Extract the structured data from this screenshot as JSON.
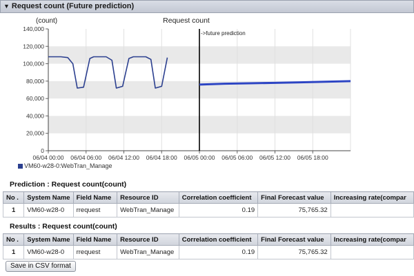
{
  "panel": {
    "title": "Request count (Future prediction)"
  },
  "chart_data": {
    "type": "line",
    "title": "Request count",
    "ylabel": "(count)",
    "ylim": [
      0,
      140000
    ],
    "yticks": [
      "0",
      "20,000",
      "40,000",
      "60,000",
      "80,000",
      "100,000",
      "120,000",
      "140,000"
    ],
    "x_tick_labels": [
      "06/04 00:00",
      "06/04 06:00",
      "06/04 12:00",
      "06/04 18:00",
      "06/05 00:00",
      "06/05 06:00",
      "06/05 12:00",
      "06/05 18:00"
    ],
    "xlim_hours": [
      0,
      48
    ],
    "divider_hour": 24,
    "annotation": "->future prediction",
    "legend": [
      "VM60-w28-0:WebTran_Manage"
    ],
    "series": [
      {
        "name": "VM60-w28-0:WebTran_Manage",
        "kind": "actual",
        "points": [
          [
            0,
            108000
          ],
          [
            2,
            108000
          ],
          [
            3.1,
            107000
          ],
          [
            3.9,
            100000
          ],
          [
            4.6,
            72000
          ],
          [
            5.6,
            73000
          ],
          [
            6.6,
            106000
          ],
          [
            7.2,
            108000
          ],
          [
            9.2,
            108000
          ],
          [
            10.1,
            104000
          ],
          [
            10.8,
            72000
          ],
          [
            11.8,
            74000
          ],
          [
            12.8,
            106000
          ],
          [
            13.5,
            108000
          ],
          [
            15.5,
            108000
          ],
          [
            16.3,
            105000
          ],
          [
            17.0,
            72000
          ],
          [
            18.0,
            74000
          ],
          [
            18.9,
            107000
          ]
        ]
      },
      {
        "name": "VM60-w28-0:WebTran_Manage",
        "kind": "prediction",
        "points": [
          [
            24,
            76000
          ],
          [
            28,
            77000
          ],
          [
            32,
            77500
          ],
          [
            36,
            78000
          ],
          [
            40,
            78600
          ],
          [
            44,
            79300
          ],
          [
            48,
            80000
          ]
        ]
      }
    ]
  },
  "prediction": {
    "title": "Prediction : Request count(count)",
    "columns": [
      "No .",
      "System Name",
      "Field Name",
      "Resource ID",
      "Correlation coefficient",
      "Final Forecast value",
      "Increasing rate(compar"
    ],
    "rows": [
      [
        "1",
        "VM60-w28-0",
        "rrequest",
        "WebTran_Manage",
        "0.19",
        "75,765.32",
        ""
      ]
    ]
  },
  "results": {
    "title": "Results : Request count(count)",
    "columns": [
      "No .",
      "System Name",
      "Field Name",
      "Resource ID",
      "Correlation coefficient",
      "Final Forecast value",
      "Increasing rate(compar"
    ],
    "rows": [
      [
        "1",
        "VM60-w28-0",
        "rrequest",
        "WebTran_Manage",
        "0.19",
        "75,765.32",
        ""
      ]
    ]
  },
  "csv_button": {
    "label": "Save in CSV format"
  },
  "colors": {
    "line": "#2b3f8f",
    "prediction": "#2d45c4",
    "band": "#e9e9e9"
  }
}
